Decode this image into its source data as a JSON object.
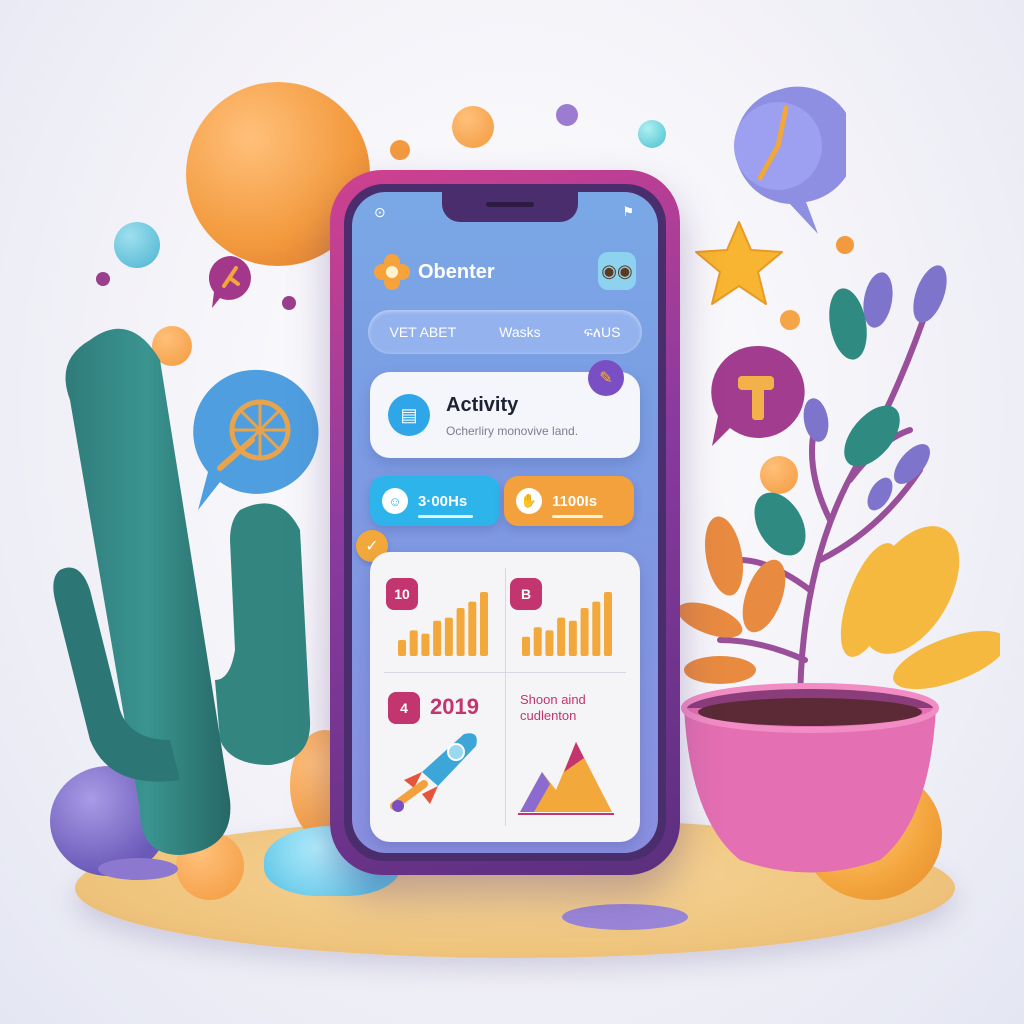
{
  "app": {
    "title": "Obenter",
    "status_left": "⊙",
    "status_right": "⚑"
  },
  "nav": {
    "items": [
      "VET ABET",
      "Wasks",
      "ፍለUS"
    ]
  },
  "activity": {
    "title": "Activity",
    "subtitle": "Ocherliry monovive land."
  },
  "stats": [
    {
      "label": "3·00Hs",
      "color": "#2db4ea",
      "icon": "face-icon"
    },
    {
      "label": "1100Is",
      "color": "#f2a13c",
      "icon": "thumb-icon"
    }
  ],
  "dashboard": {
    "tile1_badge": "10",
    "tile2_badge": "B",
    "tile3_badge": "4",
    "tile1_bars": [
      0.25,
      0.4,
      0.35,
      0.55,
      0.6,
      0.75,
      0.85,
      1.0
    ],
    "tile2_bars": [
      0.3,
      0.45,
      0.4,
      0.6,
      0.55,
      0.75,
      0.85,
      1.0
    ],
    "year": "2019",
    "caption": "Shoon aind cudlenton"
  },
  "colors": {
    "accent_pink": "#c2356f",
    "bar_orange": "#f2a83a",
    "phone_frame": "#b63d94",
    "screen_blue": "#7aa8e6"
  }
}
